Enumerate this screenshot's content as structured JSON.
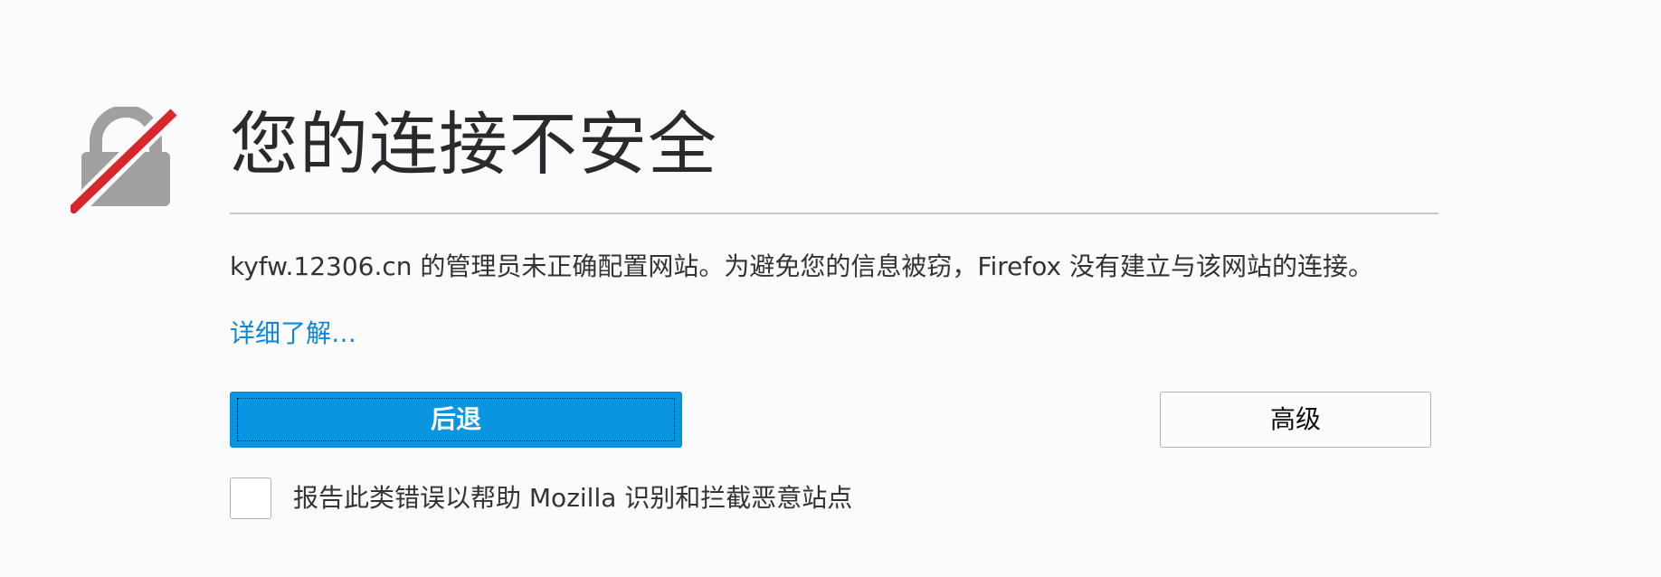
{
  "icon": "broken-lock-icon",
  "colors": {
    "lock_gray": "#a0a0a0",
    "slash_red": "#d7262c",
    "primary_button": "#0996e0",
    "link": "#1088d8"
  },
  "title": "您的连接不安全",
  "description": "kyfw.12306.cn 的管理员未正确配置网站。为避免您的信息被窃，Firefox 没有建立与该网站的连接。",
  "learn_more": "详细了解…",
  "buttons": {
    "back": "后退",
    "advanced": "高级"
  },
  "report": {
    "checked": false,
    "label": "报告此类错误以帮助 Mozilla 识别和拦截恶意站点"
  }
}
